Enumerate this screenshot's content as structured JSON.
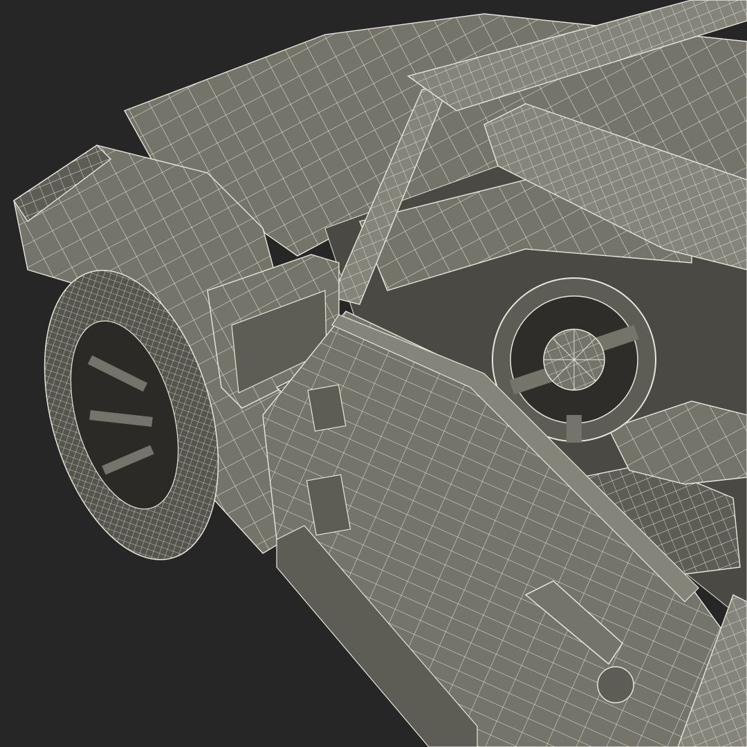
{
  "scene": {
    "subject": "jeep-wireframe-render",
    "colors": {
      "background": "#262626",
      "surface": "#75746b",
      "surface_light": "#85847a",
      "surface_dark": "#5e5d55",
      "shadow": "#3e3d38",
      "wire": "#e9e7d9",
      "interior": "#4a4944",
      "tire": "#55544d"
    }
  }
}
